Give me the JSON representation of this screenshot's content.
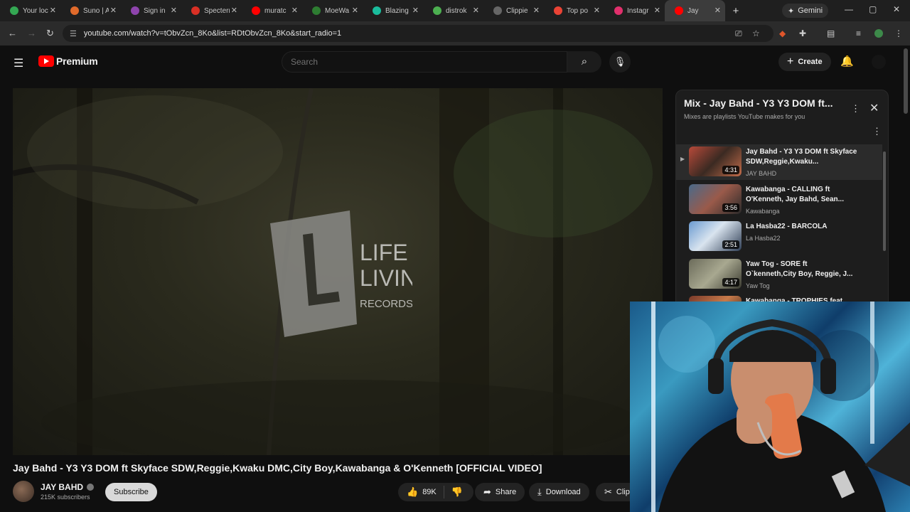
{
  "browser": {
    "tabs": [
      {
        "title": "Your loc",
        "color": "#34a853"
      },
      {
        "title": "Suno | A",
        "color": "#e06a2b"
      },
      {
        "title": "Sign in",
        "color": "#8e44ad"
      },
      {
        "title": "Specterr",
        "color": "#d93025"
      },
      {
        "title": "muratc",
        "color": "#ff0000"
      },
      {
        "title": "MoeWa",
        "color": "#2e7d32"
      },
      {
        "title": "Blazing",
        "color": "#1abc9c"
      },
      {
        "title": "distrok",
        "color": "#4caf50"
      },
      {
        "title": "Clippie",
        "color": "#666666"
      },
      {
        "title": "Top po",
        "color": "#ea4335"
      },
      {
        "title": "Instagr",
        "color": "#e1306c"
      },
      {
        "title": "Jay",
        "color": "#ff0000",
        "active": true
      }
    ],
    "new_tab": "+",
    "gemini_label": "Gemini",
    "url": "youtube.com/watch?v=tObvZcn_8Ko&list=RDtObvZcn_8Ko&start_radio=1"
  },
  "youtube": {
    "logo_text": "Premium",
    "search_placeholder": "Search",
    "create_label": "Create"
  },
  "video": {
    "watermark_line1": "LIFE",
    "watermark_line2": "LIVING",
    "watermark_line3": "RECORDS",
    "title": "Jay Bahd - Y3 Y3 DOM ft Skyface SDW,Reggie,Kwaku DMC,City Boy,Kawabanga & O'Kenneth [OFFICIAL VIDEO]",
    "channel": "JAY BAHD",
    "subscribers": "215K subscribers",
    "subscribe_label": "Subscribe",
    "likes": "89K",
    "share_label": "Share",
    "download_label": "Download",
    "clip_label": "Clip"
  },
  "playlist": {
    "title": "Mix - Jay Bahd - Y3 Y3 DOM ft...",
    "subtitle": "Mixes are playlists YouTube makes for you",
    "items": [
      {
        "title": "Jay Bahd - Y3 Y3 DOM ft Skyface SDW,Reggie,Kwaku...",
        "channel": "JAY BAHD",
        "duration": "4:31",
        "current": true
      },
      {
        "title": "Kawabanga - CALLING ft O'Kenneth, Jay Bahd, Sean...",
        "channel": "Kawabanga",
        "duration": "3:56"
      },
      {
        "title": "La Hasba22 - BARCOLA",
        "channel": "La Hasba22",
        "duration": "2:51"
      },
      {
        "title": "Yaw Tog - SORE ft O`kenneth,City Boy, Reggie, J...",
        "channel": "Yaw Tog",
        "duration": "4:17"
      },
      {
        "title": "Kawabanga - TROPHIES feat.",
        "channel": "",
        "duration": ""
      }
    ]
  }
}
